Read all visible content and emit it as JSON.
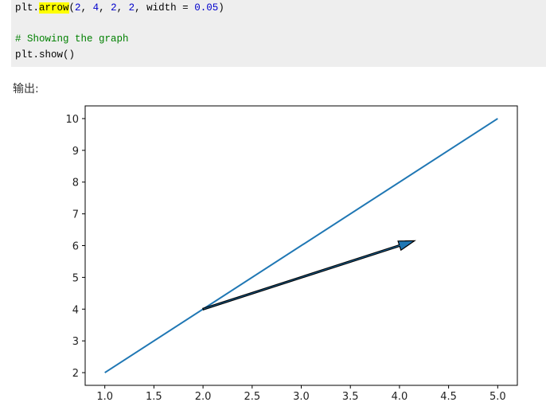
{
  "code": {
    "line1_prefix": "plt.",
    "line1_func": "arrow",
    "line1_open": "(",
    "line1_args": [
      "2",
      "4",
      "2",
      "2"
    ],
    "line1_kw": "width = ",
    "line1_width": "0.05",
    "line1_close": ")",
    "comment": "# Showing the graph",
    "line3": "plt.show()"
  },
  "output_label": "输出:",
  "colors": {
    "line": "#1f77b4",
    "arrow_edge": "#000000",
    "arrow_fill": "#1f77b4",
    "highlight": "#ffff00"
  },
  "chart_data": {
    "type": "line",
    "title": "",
    "xlabel": "",
    "ylabel": "",
    "xlim": [
      0.8,
      5.2
    ],
    "ylim": [
      1.6,
      10.4
    ],
    "xticks": [
      "1.0",
      "1.5",
      "2.0",
      "2.5",
      "3.0",
      "3.5",
      "4.0",
      "4.5",
      "5.0"
    ],
    "yticks": [
      "2",
      "3",
      "4",
      "5",
      "6",
      "7",
      "8",
      "9",
      "10"
    ],
    "grid": false,
    "series": [
      {
        "x": [
          1,
          5
        ],
        "y": [
          2,
          10
        ]
      }
    ],
    "arrow": {
      "x": 2,
      "y": 4,
      "dx": 2,
      "dy": 2,
      "width": 0.05
    }
  }
}
